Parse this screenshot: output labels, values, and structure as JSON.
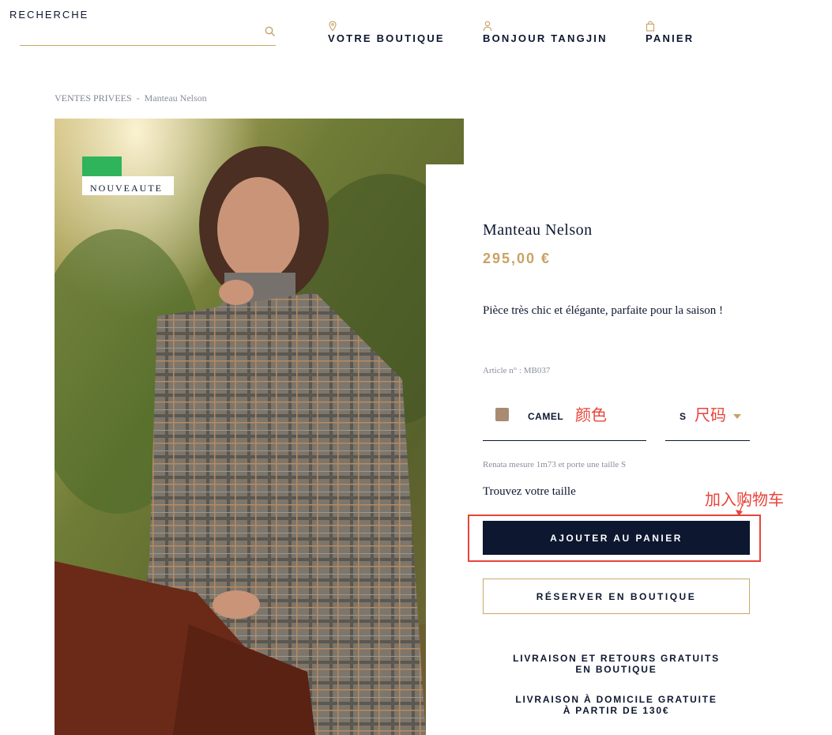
{
  "header": {
    "search_placeholder": "RECHERCHE",
    "nav": {
      "store": "VOTRE BOUTIQUE",
      "account": "BONJOUR TANGJIN",
      "cart": "PANIER"
    }
  },
  "breadcrumb": {
    "parent": "VENTES PRIVEES",
    "separator": "-",
    "current": "Manteau Nelson"
  },
  "badge": {
    "label": "NOUVEAUTE"
  },
  "product": {
    "name": "Manteau Nelson",
    "price": "295,00 €",
    "description": "Pièce très chic et élégante, parfaite pour la saison !",
    "article": "Article n° : MB037",
    "color": {
      "label": "CAMEL",
      "swatch": "#a98b72"
    },
    "size": {
      "value": "S"
    },
    "model_info": "Renata mesure 1m73 et porte une taille S",
    "find_size": "Trouvez votre taille",
    "add_to_cart": "AJOUTER AU PANIER",
    "reserve": "RÉSERVER EN BOUTIQUE",
    "shipping": {
      "line1a": "LIVRAISON ET RETOURS GRATUITS",
      "line1b": "EN BOUTIQUE",
      "line2a": "LIVRAISON À DOMICILE GRATUITE",
      "line2b": "À PARTIR DE 130€"
    }
  },
  "annotations": {
    "color": "颜色",
    "size": "尺码",
    "add_to_cart": "加入购物车"
  },
  "colors": {
    "navy": "#0d1730",
    "gold": "#c8a265",
    "annotation_red": "#e8443a",
    "badge_green": "#2fb45c"
  }
}
